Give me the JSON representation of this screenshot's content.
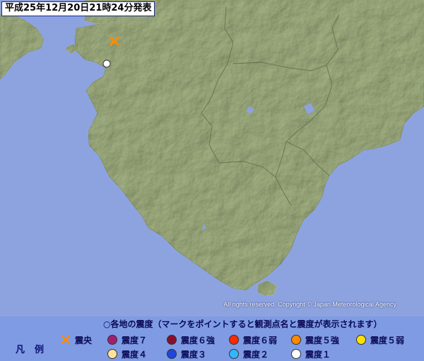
{
  "header": {
    "issued": "平成25年12月20日21時24分発表"
  },
  "copyright": "All rights reserved. Copyright © Japan Meteorological Agency",
  "legend": {
    "caption": "凡例",
    "note": "○各地の震度（マークをポイントすると観測点名と震度が表示されます）",
    "epicenter_label": "震央",
    "epicenter_color": "#ff8c00",
    "items": [
      {
        "label": "震度７",
        "color": "#a0206f"
      },
      {
        "label": "震度６強",
        "color": "#8b0f2a"
      },
      {
        "label": "震度６弱",
        "color": "#ff2a00"
      },
      {
        "label": "震度５強",
        "color": "#ff8a00"
      },
      {
        "label": "震度５弱",
        "color": "#ffe000"
      },
      {
        "label": "震度４",
        "color": "#ffe39a"
      },
      {
        "label": "震度３",
        "color": "#1f45e0"
      },
      {
        "label": "震度２",
        "color": "#2fb8ff"
      },
      {
        "label": "震度１",
        "color": "#ffffff"
      }
    ]
  },
  "map": {
    "land_color": "#a5b484",
    "sea_color": "#8da3df",
    "epicenter": {
      "icon": "epicenter-x-icon"
    },
    "stations": [
      {
        "intensity": "震度１",
        "color": "#ffffff"
      }
    ]
  }
}
